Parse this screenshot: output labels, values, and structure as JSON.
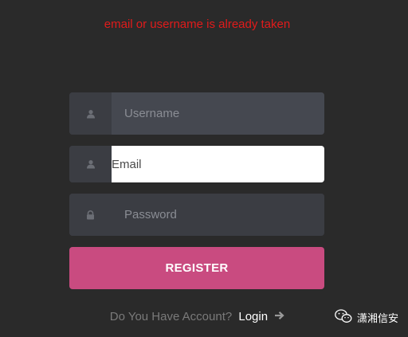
{
  "error": {
    "message": "email or username is already taken"
  },
  "form": {
    "username": {
      "placeholder": "Username",
      "value": "",
      "icon": "user-icon"
    },
    "email": {
      "placeholder": "Email",
      "value": "",
      "icon": "user-icon"
    },
    "password": {
      "placeholder": "Password",
      "value": "",
      "icon": "lock-icon"
    },
    "register_label": "REGISTER"
  },
  "footer": {
    "question": "Do You Have Account?",
    "login_label": "Login",
    "login_icon": "arrow-right-icon"
  },
  "watermark": {
    "text": "潇湘信安",
    "icon": "wechat-icon"
  },
  "colors": {
    "background": "#2a2a2a",
    "error": "#e11b1b",
    "accent": "#c94b80",
    "field": "#454850"
  }
}
